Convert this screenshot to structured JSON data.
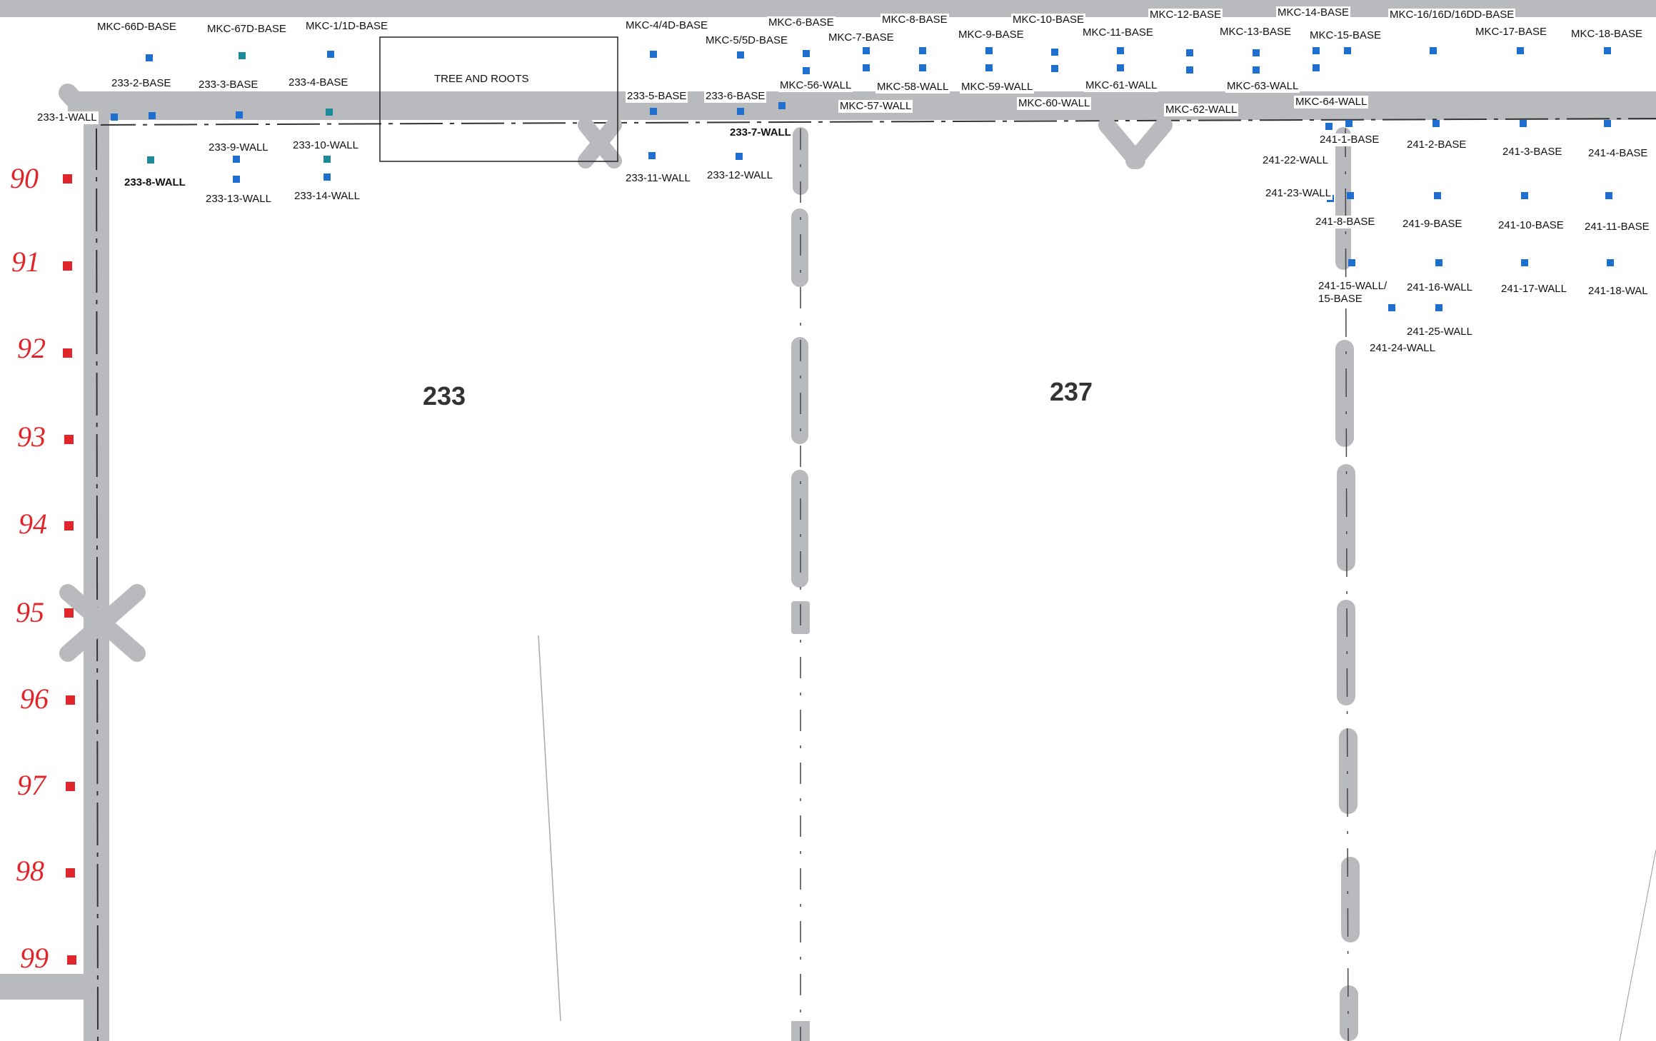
{
  "rooms": {
    "r233": "233",
    "r237": "237"
  },
  "tree_note": "TREE AND ROOTS",
  "grid_numbers": [
    "90",
    "91",
    "92",
    "93",
    "94",
    "95",
    "96",
    "97",
    "98",
    "99"
  ],
  "labels": {
    "mkc66d": "MKC-66D-BASE",
    "mkc67d": "MKC-67D-BASE",
    "mkc1": "MKC-1/1D-BASE",
    "mkc4": "MKC-4/4D-BASE",
    "mkc5": "MKC-5/5D-BASE",
    "mkc6": "MKC-6-BASE",
    "mkc7": "MKC-7-BASE",
    "mkc8": "MKC-8-BASE",
    "mkc9": "MKC-9-BASE",
    "mkc10": "MKC-10-BASE",
    "mkc11": "MKC-11-BASE",
    "mkc12": "MKC-12-BASE",
    "mkc13": "MKC-13-BASE",
    "mkc14": "MKC-14-BASE",
    "mkc15": "MKC-15-BASE",
    "mkc16": "MKC-16/16D/16DD-BASE",
    "mkc17": "MKC-17-BASE",
    "mkc18": "MKC-18-BASE",
    "b233_2": "233-2-BASE",
    "b233_3": "233-3-BASE",
    "b233_4": "233-4-BASE",
    "b233_5": "233-5-BASE",
    "b233_6": "233-6-BASE",
    "w233_1": "233-1-WALL",
    "w233_7": "233-7-WALL",
    "w233_8": "233-8-WALL",
    "w233_9": "233-9-WALL",
    "w233_10": "233-10-WALL",
    "w233_11": "233-11-WALL",
    "w233_12": "233-12-WALL",
    "w233_13": "233-13-WALL",
    "w233_14": "233-14-WALL",
    "mkc56": "MKC-56-WALL",
    "mkc57": "MKC-57-WALL",
    "mkc58": "MKC-58-WALL",
    "mkc59": "MKC-59-WALL",
    "mkc60": "MKC-60-WALL",
    "mkc61": "MKC-61-WALL",
    "mkc62": "MKC-62-WALL",
    "mkc63": "MKC-63-WALL",
    "mkc64": "MKC-64-WALL",
    "b241_1": "241-1-BASE",
    "b241_2": "241-2-BASE",
    "b241_3": "241-3-BASE",
    "b241_4": "241-4-BASE",
    "b241_8": "241-8-BASE",
    "b241_9": "241-9-BASE",
    "b241_10": "241-10-BASE",
    "b241_11": "241-11-BASE",
    "w241_15": "241-15-WALL/\n15-BASE",
    "w241_16": "241-16-WALL",
    "w241_17": "241-17-WALL",
    "w241_18": "241-18-WAL",
    "w241_22": "241-22-WALL",
    "w241_23": "241-23-WALL",
    "w241_24": "241-24-WALL",
    "w241_25": "241-25-WALL"
  },
  "colors": {
    "marker": "#1e6fcf",
    "wall": "#b8babd",
    "grid": "#e0262a"
  }
}
